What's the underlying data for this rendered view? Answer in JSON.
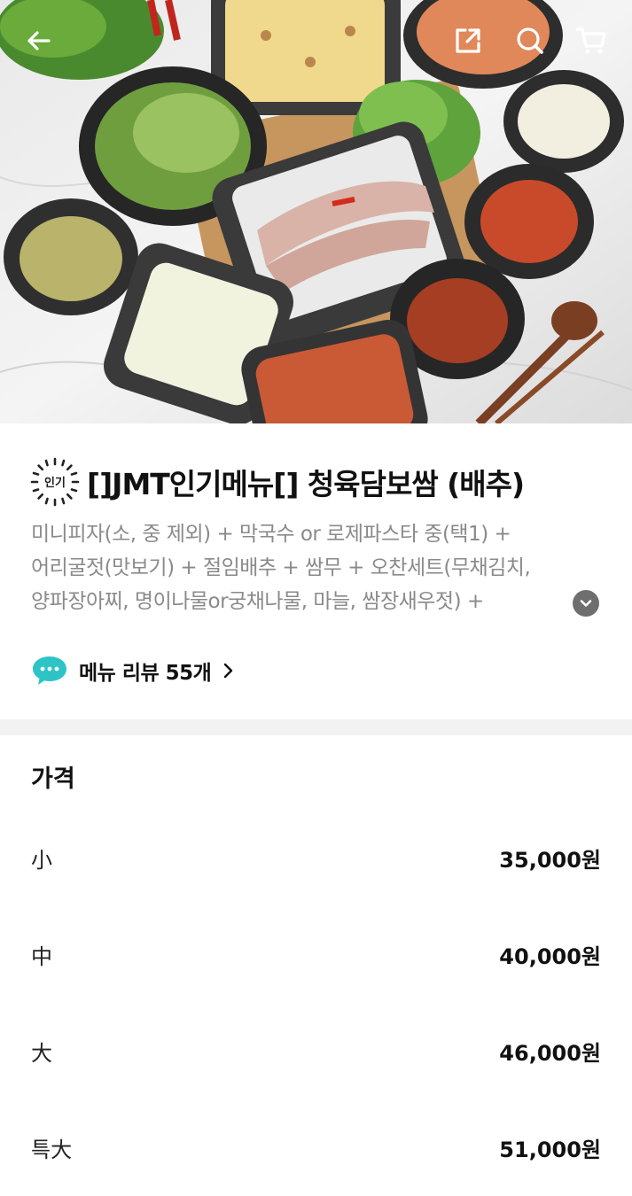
{
  "header": {
    "icons": [
      "back-arrow-icon",
      "share-icon",
      "search-icon",
      "cart-icon"
    ]
  },
  "menu": {
    "badge_text": "인기",
    "title": "[]JMT인기메뉴[]  청육담보쌈 (배추)",
    "description_lines": [
      "미니피자(소, 중 제외) + 막국수 or 로제파스타 중(택1) +",
      "어리굴젓(맛보기) + 절임배추 + 쌈무 + 오찬세트(무채김치,",
      "양파장아찌, 명이나물or궁채나물, 마늘, 쌈장새우젓) +"
    ],
    "review_label": "메뉴 리뷰 55개"
  },
  "price": {
    "title": "가격",
    "rows": [
      {
        "size": "小",
        "amount": "35,000원"
      },
      {
        "size": "中",
        "amount": "40,000원"
      },
      {
        "size": "大",
        "amount": "46,000원"
      },
      {
        "size": "특大",
        "amount": "51,000원"
      }
    ]
  },
  "colors": {
    "text": "#111111",
    "subtext": "#8a8a8a",
    "divider": "#f2f2f2",
    "review_icon": "#2ec4c6"
  }
}
